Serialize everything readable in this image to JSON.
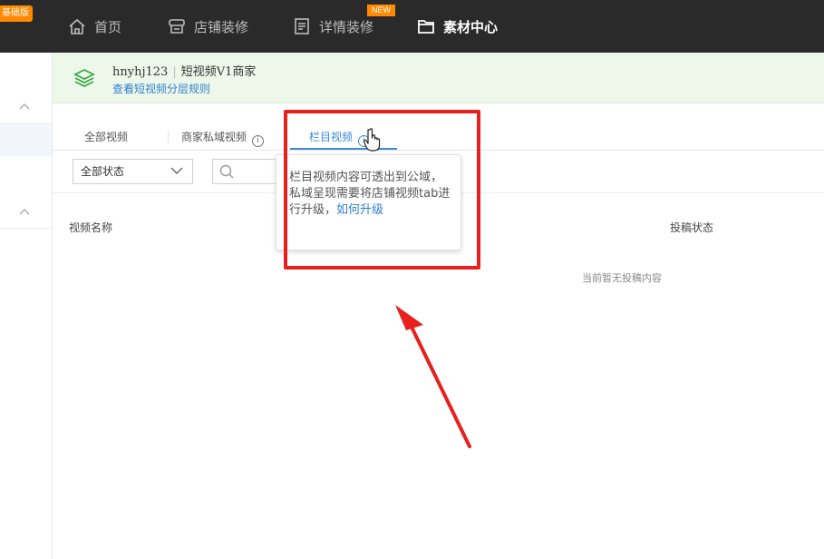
{
  "topbar": {
    "badge": "基础版",
    "nav": [
      {
        "label": "首页",
        "icon": "home-icon"
      },
      {
        "label": "店铺装修",
        "icon": "store-icon"
      },
      {
        "label": "详情装修",
        "icon": "document-icon"
      },
      {
        "label": "素材中心",
        "icon": "folder-icon"
      }
    ],
    "new_tag": "NEW"
  },
  "account": {
    "username": "hnyhj123",
    "level": "短视频V1商家",
    "rule_link": "查看短视频分层规则"
  },
  "tabs": [
    {
      "label": "全部视频"
    },
    {
      "label": "商家私域视频",
      "info": "i"
    },
    {
      "label": "栏目视频",
      "info": "i",
      "active": true
    }
  ],
  "filter": {
    "status_select": "全部状态"
  },
  "table": {
    "col_name": "视频名称",
    "col_status": "投稿状态",
    "empty_text": "当前暂无投稿内容"
  },
  "tooltip": {
    "text": "栏目视频内容可透出到公域，私域呈现需要将店铺视频tab进行升级，",
    "link": "如何升级"
  },
  "colors": {
    "topbar_bg": "#2a2a2a",
    "accent": "#3d8ad9",
    "badge": "#ff8a00",
    "annotation": "#e8201d"
  }
}
